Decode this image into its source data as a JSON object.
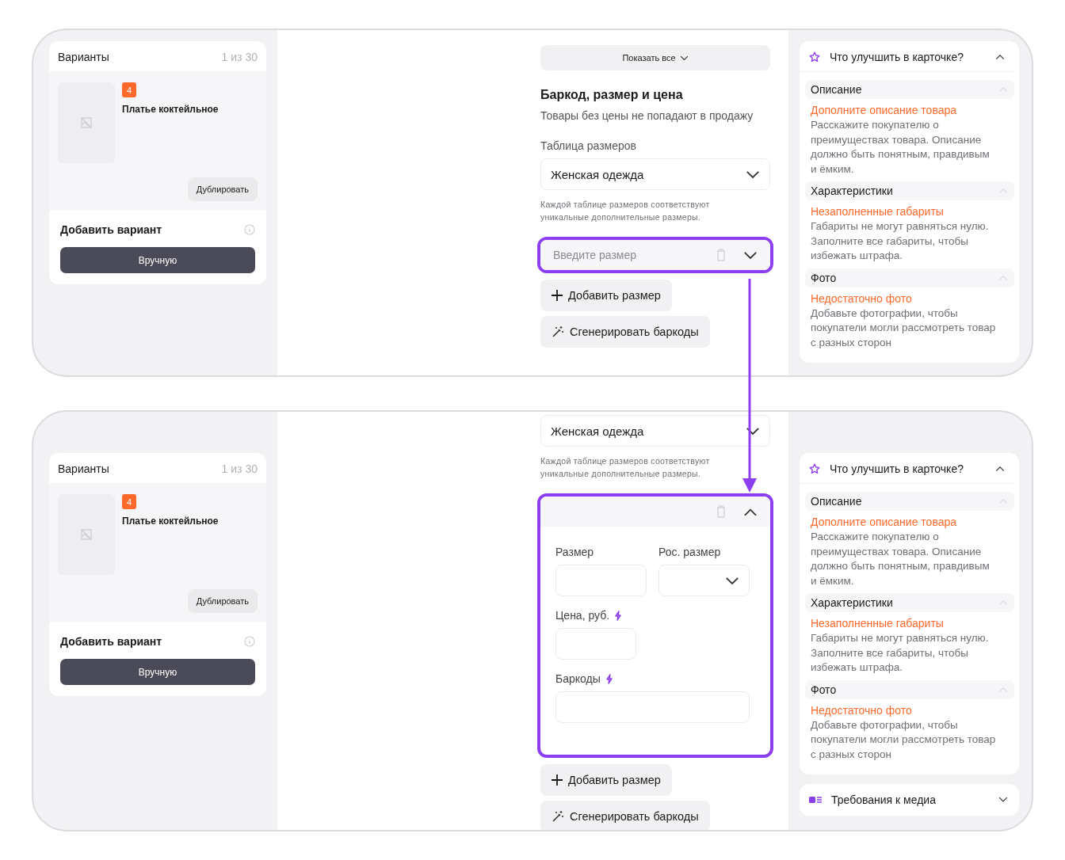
{
  "screens": [
    {
      "variants": {
        "title": "Варианты",
        "counter": "1 из 30",
        "badge": "4",
        "product": "Платье коктейльное",
        "duplicate": "Дублировать",
        "add_title": "Добавить вариант",
        "manual": "Вручную"
      },
      "form": [
        {
          "kind": "show_all",
          "text": "Показать все"
        },
        {
          "kind": "heading",
          "text": "Баркод, размер и цена"
        },
        {
          "kind": "subtitle",
          "text": "Товары без цены не попадают в продажу"
        },
        {
          "kind": "label",
          "text": "Таблица размеров"
        },
        {
          "kind": "select",
          "text": "Женская одежда"
        },
        {
          "kind": "hint",
          "text": "Каждой таблице размеров соответствуют уникальные дополнительные размеры."
        },
        {
          "kind": "size_entry",
          "highlighted": true,
          "expanded": false,
          "placeholder": "Введите размер"
        },
        {
          "kind": "add",
          "text": "Добавить размер"
        },
        {
          "kind": "generate",
          "text": "Сгенерировать баркоды"
        }
      ],
      "tips": {
        "title": "Что улучшить в карточке?",
        "expanded": true,
        "sections": [
          {
            "title": "Описание",
            "expanded": true,
            "warning": "Дополните описание товара",
            "text": "Расскажите покупателю о преимуществах товара. Описание должно быть понятным, правдивым и ёмким."
          },
          {
            "title": "Характеристики",
            "expanded": true,
            "warning": "Незаполненные габариты",
            "text": "Габариты не могут равняться нулю. Заполните все габариты, чтобы избежать штрафа."
          },
          {
            "title": "Фото",
            "expanded": true,
            "warning": "Недостаточно фото",
            "text": "Добавьте фотографии, чтобы покупатели могли рассмотреть товар с разных сторон"
          }
        ]
      }
    },
    {
      "variants": {
        "title": "Варианты",
        "counter": "1 из 30",
        "badge": "4",
        "product": "Платье коктейльное",
        "duplicate": "Дублировать",
        "add_title": "Добавить вариант",
        "manual": "Вручную"
      },
      "form": [
        {
          "kind": "select",
          "text": "Женская одежда"
        },
        {
          "kind": "hint",
          "text": "Каждой таблице размеров соответствуют уникальные дополнительные размеры."
        },
        {
          "kind": "size_entry",
          "highlighted": true,
          "expanded": true,
          "fields": [
            {
              "kind": "text",
              "label": "Размер",
              "ai": false
            },
            {
              "kind": "select",
              "label": "Рос. размер",
              "ai": false
            },
            {
              "kind": "text",
              "label": "Цена, руб.",
              "ai": true
            },
            {
              "kind": "wide",
              "label": "Баркоды",
              "ai": true
            }
          ]
        },
        {
          "kind": "add",
          "text": "Добавить размер"
        },
        {
          "kind": "generate",
          "text": "Сгенерировать баркоды"
        }
      ],
      "tips": {
        "title": "Что улучшить в карточке?",
        "expanded": true,
        "sections": [
          {
            "title": "Описание",
            "expanded": true,
            "warning": "Дополните описание товара",
            "text": "Расскажите покупателю о преимуществах товара. Описание должно быть понятным, правдивым и ёмким."
          },
          {
            "title": "Характеристики",
            "expanded": true,
            "warning": "Незаполненные габариты",
            "text": "Габариты не могут равняться нулю. Заполните все габариты, чтобы избежать штрафа."
          },
          {
            "title": "Фото",
            "expanded": true,
            "warning": "Недостаточно фото",
            "text": "Добавьте фотографии, чтобы покупатели могли рассмотреть товар с разных сторон"
          }
        ]
      },
      "media": {
        "title": "Требования к медиа",
        "expanded": false
      }
    }
  ]
}
